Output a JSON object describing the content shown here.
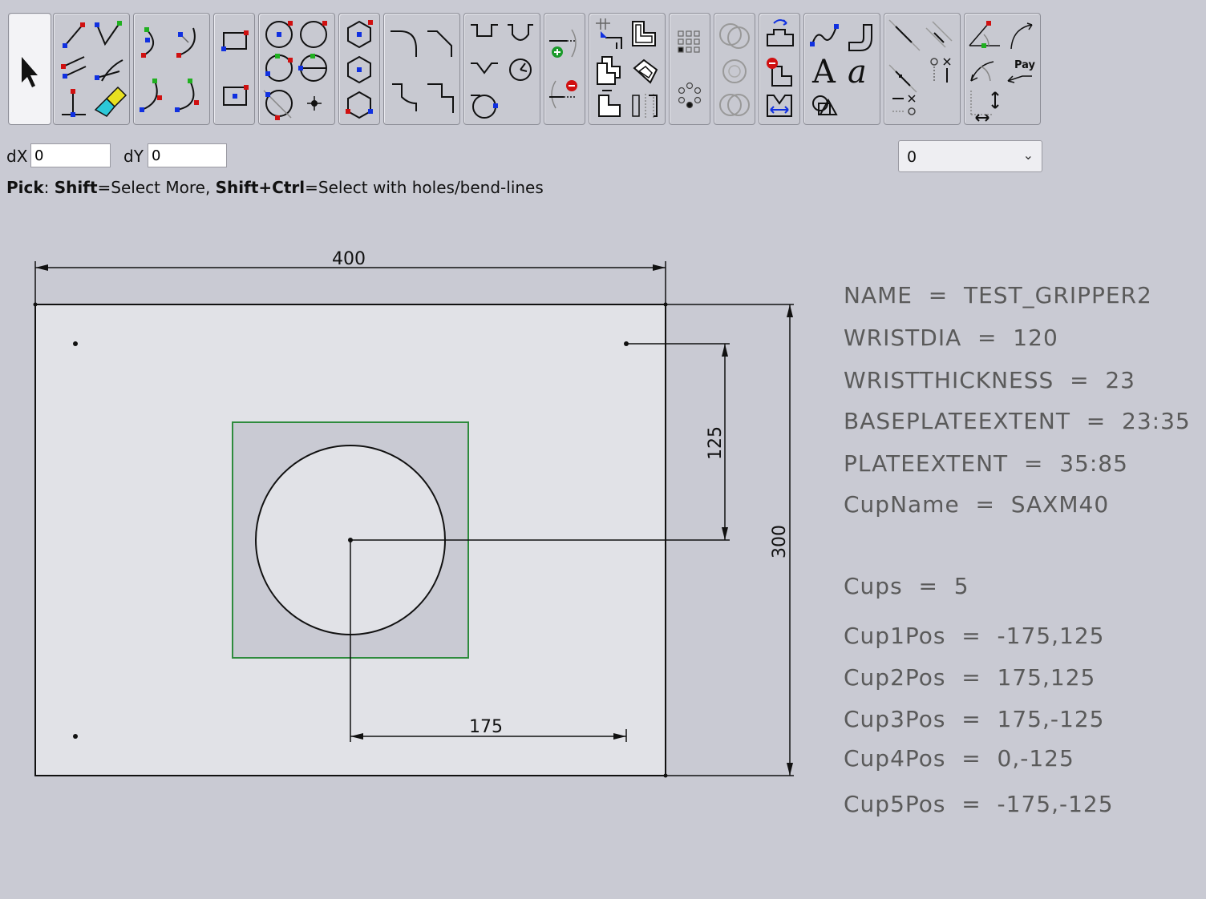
{
  "toolbar": {
    "groups": [
      {
        "id": "select",
        "icons": [
          "pointer-arrow-icon"
        ]
      },
      {
        "id": "lines",
        "icons": [
          "line-2pt-icon",
          "polyline-icon",
          "parallel-line-icon",
          "tangent-line-icon",
          "perpendicular-line-icon",
          "trim-eraser-icon"
        ]
      },
      {
        "id": "arcs",
        "icons": [
          "arc-3pt-icon",
          "arc-center-icon",
          "arc-start-icon",
          "arc-end-icon"
        ]
      },
      {
        "id": "rectangles",
        "icons": [
          "rectangle-icon",
          "rectangle-center-icon"
        ]
      },
      {
        "id": "circles",
        "icons": [
          "circle-center-icon",
          "circle-radius-icon",
          "circle-3pt-icon",
          "circle-diameter-icon",
          "circle-tangent-icon",
          "point-icon"
        ]
      },
      {
        "id": "polygons",
        "icons": [
          "hexagon-icon",
          "hexagon-center-icon",
          "hexagon-outline-icon"
        ]
      },
      {
        "id": "corners",
        "icons": [
          "fillet-icon",
          "chamfer-icon",
          "corner-notch-icon",
          "corner-step-icon"
        ]
      },
      {
        "id": "slots",
        "icons": [
          "slot-u-icon",
          "slot-round-icon",
          "v-notch-icon",
          "keyhole-icon",
          "obround-icon"
        ]
      },
      {
        "id": "nodes",
        "icons": [
          "add-node-icon",
          "remove-node-icon"
        ]
      },
      {
        "id": "transform",
        "icons": [
          "move-icon",
          "offset-shape-icon",
          "copy-shape-icon",
          "rotate-shape-icon",
          "mirror-shape-icon",
          "measure-shape-icon"
        ]
      },
      {
        "id": "patterns",
        "icons": [
          "grid-pattern-icon",
          "circular-pattern-icon"
        ]
      },
      {
        "id": "boolean",
        "icons": [
          "union-icon",
          "subtract-icon",
          "intersect-icon"
        ]
      },
      {
        "id": "sheet",
        "icons": [
          "flip-icon",
          "remove-feature-icon",
          "fit-icon"
        ]
      },
      {
        "id": "annotate",
        "icons": [
          "spline-icon",
          "bend-icon",
          "text-icon",
          "font-icon",
          "shapes-icon"
        ]
      },
      {
        "id": "constraints",
        "icons": [
          "align-icon",
          "parallel-constraint-icon",
          "distance-constraint-icon",
          "fix-point-icon",
          "delete-constraint-icon"
        ]
      },
      {
        "id": "dimensions",
        "icons": [
          "angle-dim-icon",
          "radius-dim-icon",
          "diameter-dim-icon",
          "parameter-dim-icon",
          "linear-dim-icon"
        ]
      }
    ],
    "pay_label": "Pay"
  },
  "fields": {
    "dx_label": "dX",
    "dx_value": "0",
    "dy_label": "dY",
    "dy_value": "0"
  },
  "layer_select": {
    "value": "0"
  },
  "hint": {
    "pick": "Pick",
    "sep1": ": ",
    "shift": "Shift",
    "shift_desc": "=Select More, ",
    "shift_ctrl": "Shift+Ctrl",
    "shift_ctrl_desc": "=Select with holes/bend-lines"
  },
  "drawing": {
    "dim_width": "400",
    "dim_height": "300",
    "dim_offset_y": "125",
    "dim_offset_x": "175",
    "plate_color": "#e1e2e7",
    "wrist_square_color": "#2e8b3d"
  },
  "parameters": [
    "NAME  =  TEST_GRIPPER2",
    "WRISTDIA  =  120",
    "WRISTTHICKNESS  =  23",
    "BASEPLATEEXTENT  =  23:35",
    "PLATEEXTENT  =  35:85",
    "CupName  =  SAXM40",
    "Cups  =  5",
    "Cup1Pos  =  -175,125",
    "Cup2Pos  =  175,125",
    "Cup3Pos  =  175,-125",
    "Cup4Pos  =  0,-125",
    "Cup5Pos  =  -175,-125"
  ]
}
